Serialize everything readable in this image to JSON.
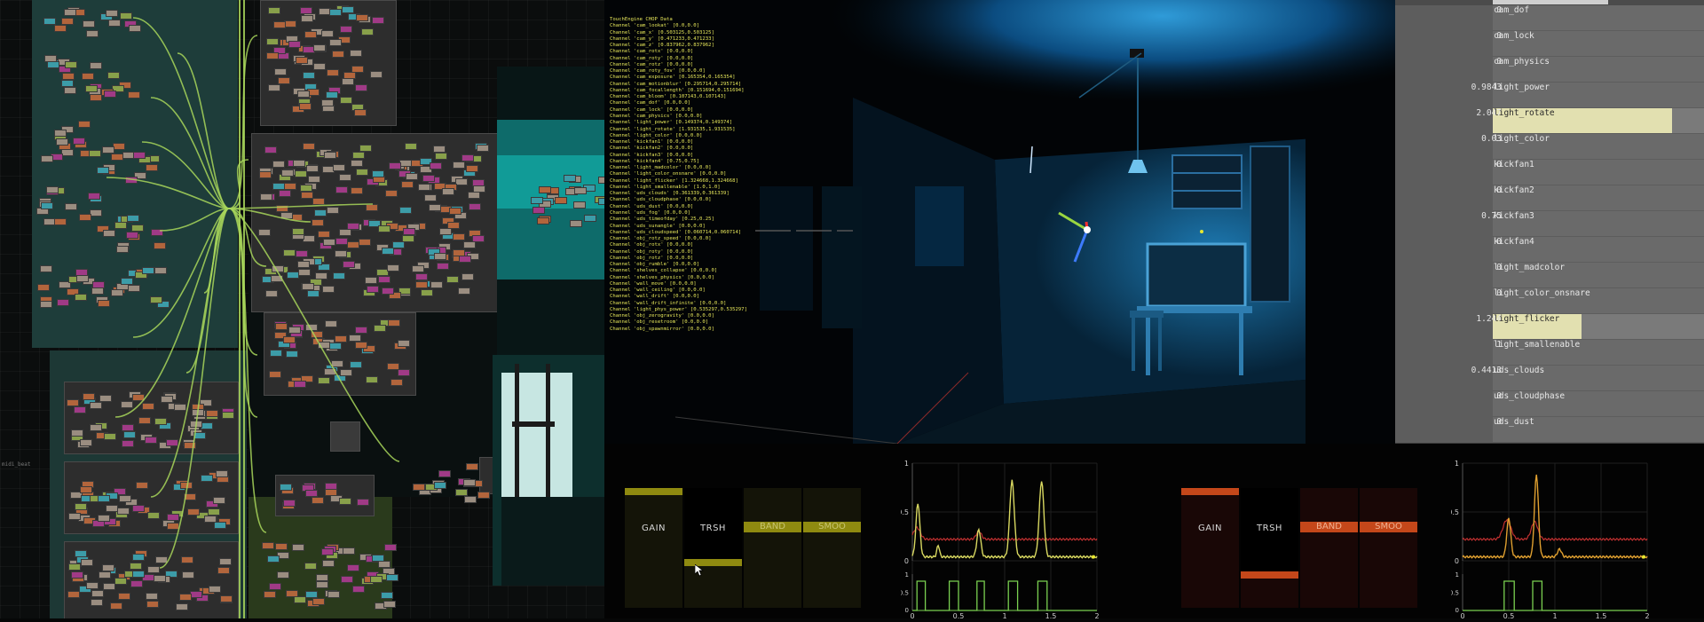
{
  "chop_text": {
    "title": "TouchEngine CHOP Data",
    "lines": [
      "Channel 'cam_lookat' [0.0,0.0]",
      "Channel 'cam_x' [0.503125,0.503125]",
      "Channel 'cam_y' [0.471233,0.471233]",
      "Channel 'cam_z' [0.837962,0.837962]",
      "Channel 'cam_rotx' [0.0,0.0]",
      "Channel 'cam_roty' [0.0,0.0]",
      "Channel 'cam_rotz' [0.0,0.0]",
      "Channel 'cam_roty_fov' [0.0,0.0]",
      "Channel 'cam_exposure' [0.165354,0.165354]",
      "Channel 'cam_motionblur' [0.295714,0.295714]",
      "Channel 'cam_focallength' [0.151694,0.151694]",
      "Channel 'cam_bloom' [0.107143,0.107143]",
      "Channel 'cam_dof' [0.0,0.0]",
      "Channel 'cam_lock' [0.0,0.0]",
      "Channel 'cam_physics' [0.0,0.0]",
      "Channel 'light_power' [0.149374,0.149374]",
      "Channel 'light_rotate' [1.931535,1.931535]",
      "Channel 'light_color' [0.0,0.0]",
      "Channel 'kickfan1' [0.0,0.0]",
      "Channel 'kickfan2' [0.0,0.0]",
      "Channel 'kickfan3' [0.0,0.0]",
      "Channel 'kickfan4' [0.75,0.75]",
      "Channel 'light_madcolor' [0.0,0.0]",
      "Channel 'light_color_onsnare' [0.0,0.0]",
      "Channel 'light_flicker' [1.324668,1.324668]",
      "Channel 'light_smallenable' [1.0,1.0]",
      "Channel 'uds_clouds' [0.361339,0.361339]",
      "Channel 'uds_cloudphase' [0.0,0.0]",
      "Channel 'uds_dust' [0.0,0.0]",
      "Channel 'uds_fog' [0.0,0.0]",
      "Channel 'uds_timeofday' [0.25,0.25]",
      "Channel 'uds_sunangle' [0.0,0.0]",
      "Channel 'uds_cloudspeed' [0.060714,0.060714]",
      "Channel 'obj_rotz_speed' [0.0,0.0]",
      "Channel 'obj_rotx' [0.0,0.0]",
      "Channel 'obj_roty' [0.0,0.0]",
      "Channel 'obj_rotz' [0.0,0.0]",
      "Channel 'obj_rumble' [0.0,0.0]",
      "Channel 'shelves_collapse' [0.0,0.0]",
      "Channel 'shelves_physics' [0.0,0.0]",
      "Channel 'wall_move' [0.0,0.0]",
      "Channel 'wall_ceiling' [0.0,0.0]",
      "Channel 'wall_drift' [0.0,0.0]",
      "Channel 'wall_drift_infinite' [0.0,0.0]",
      "Channel 'light_phys_power' [0.535297,0.535297]",
      "Channel 'obj_zerogravity' [0.0,0.0]",
      "Channel 'obj_resetroom' [0.0,0.0]",
      "Channel 'obj_spawnmirror' [0.0,0.0]"
    ]
  },
  "params": {
    "rows": [
      {
        "value": "0",
        "name": "cam_dof",
        "level": 0
      },
      {
        "value": "0",
        "name": "cam_lock",
        "level": 0
      },
      {
        "value": "0",
        "name": "cam_physics",
        "level": 0
      },
      {
        "value": "0.9843",
        "name": "light_power",
        "level": 0
      },
      {
        "value": "2.047",
        "name": "light_rotate",
        "level": 0.85
      },
      {
        "value": "0.03",
        "name": "light_color",
        "level": 0
      },
      {
        "value": "0",
        "name": "kickfan1",
        "level": 0
      },
      {
        "value": "0",
        "name": "kickfan2",
        "level": 0
      },
      {
        "value": "0.75",
        "name": "kickfan3",
        "level": 0
      },
      {
        "value": "0",
        "name": "kickfan4",
        "level": 0
      },
      {
        "value": "0",
        "name": "light_madcolor",
        "level": 0
      },
      {
        "value": "0",
        "name": "light_color_onsnare",
        "level": 0
      },
      {
        "value": "1.244",
        "name": "light_flicker",
        "level": 0.42
      },
      {
        "value": "1",
        "name": "light_smallenable",
        "level": 0
      },
      {
        "value": "0.4413",
        "name": "uds_clouds",
        "level": 0
      },
      {
        "value": "0",
        "name": "uds_cloudphase",
        "level": 0
      },
      {
        "value": "0",
        "name": "uds_dust",
        "level": 0
      }
    ]
  },
  "left_controls": {
    "accent": "#8f8a10",
    "gain": "GAIN",
    "trsh": "TRSH",
    "band": "BAND",
    "smoo": "SMOO"
  },
  "right_controls": {
    "accent": "#c4471a",
    "gain": "GAIN",
    "trsh": "TRSH",
    "band": "BAND",
    "smoo": "SMOO"
  },
  "graph_left": {
    "y_top": "1",
    "y_mid": "0.5",
    "y_bot": "0",
    "small_1": "1",
    "small_05": "0.5",
    "small_0": "0",
    "x0": "0",
    "x05": "0.5",
    "x1": "1",
    "x15": "1.5",
    "x2": "2"
  },
  "graph_right": {
    "y_top": "1",
    "y_mid": "0.5",
    "y_bot": "0",
    "small_1": "1",
    "small_05": "0.5",
    "small_0": "0",
    "x0": "0",
    "x05": "0.5",
    "x1": "1",
    "x15": "1.5",
    "x2": "2"
  },
  "colors": {
    "yellow_trace": "#d8d860",
    "red_trace": "#c03030",
    "green_trace": "#7ad050",
    "orange_trace": "#e0a030"
  },
  "left_edge_label": "midi_beat"
}
